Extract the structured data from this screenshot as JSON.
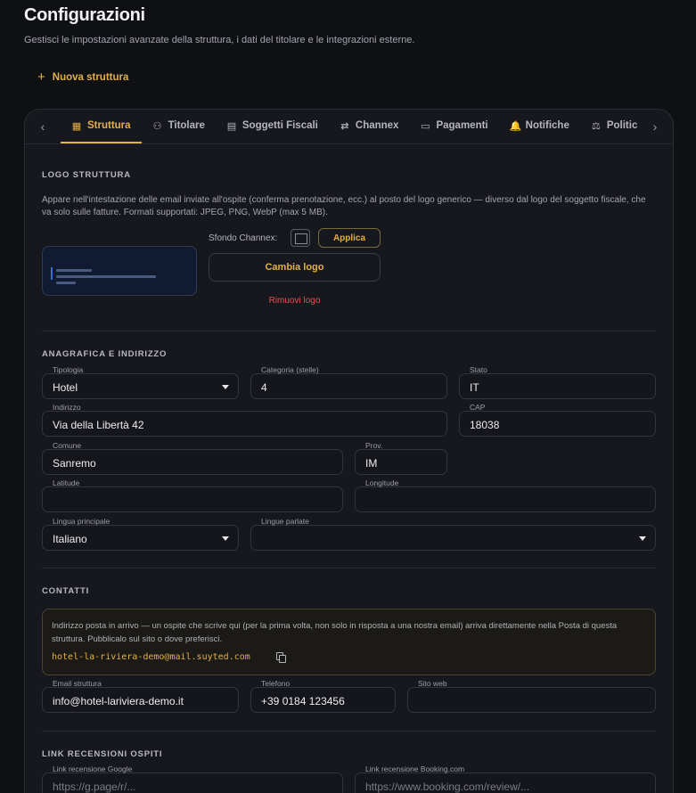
{
  "header": {
    "title": "Configurazioni",
    "subtitle": "Gestisci le impostazioni avanzate della struttura, i dati del titolare e le integrazioni esterne.",
    "new_structure_label": "Nuova struttura"
  },
  "tabs": [
    {
      "label": "Struttura",
      "icon": "building-icon",
      "glyph": "▦",
      "active": true
    },
    {
      "label": "Titolare",
      "icon": "user-icon",
      "glyph": "⚇",
      "active": false
    },
    {
      "label": "Soggetti Fiscali",
      "icon": "receipt-icon",
      "glyph": "▤",
      "active": false
    },
    {
      "label": "Channex",
      "icon": "swap-icon",
      "glyph": "⇄",
      "active": false
    },
    {
      "label": "Pagamenti",
      "icon": "credit-card-icon",
      "glyph": "▭",
      "active": false
    },
    {
      "label": "Notifiche",
      "icon": "bell-icon",
      "glyph": "🔔",
      "active": false
    },
    {
      "label": "Politic",
      "icon": "gavel-icon",
      "glyph": "⚖",
      "active": false
    }
  ],
  "logo_section": {
    "title": "LOGO STRUTTURA",
    "description": "Appare nell'intestazione delle email inviate all'ospite (conferma prenotazione, ecc.) al posto del logo generico — diverso dal logo del soggetto fiscale, che va solo sulle fatture. Formati supportati: JPEG, PNG, WebP (max 5 MB).",
    "background_label": "Sfondo Channex:",
    "apply_label": "Applica",
    "change_logo_label": "Cambia logo",
    "remove_logo_label": "Rimuovi logo"
  },
  "registry_section": {
    "title": "ANAGRAFICA E INDIRIZZO",
    "tipologia": {
      "label": "Tipologia",
      "value": "Hotel"
    },
    "categoria": {
      "label": "Categoria (stelle)",
      "value": "4"
    },
    "stato": {
      "label": "Stato",
      "value": "IT"
    },
    "indirizzo": {
      "label": "Indirizzo",
      "value": "Via della Libertà 42"
    },
    "cap": {
      "label": "CAP",
      "value": "18038"
    },
    "comune": {
      "label": "Comune",
      "value": "Sanremo"
    },
    "prov": {
      "label": "Prov.",
      "value": "IM"
    },
    "latitude": {
      "label": "Latitude",
      "value": ""
    },
    "longitude": {
      "label": "Longitude",
      "value": ""
    },
    "lingua_principale": {
      "label": "Lingua principale",
      "value": "Italiano"
    },
    "lingue_parlate": {
      "label": "Lingue parlate",
      "value": ""
    }
  },
  "contacts_section": {
    "title": "CONTATTI",
    "inbox_text": "Indirizzo posta in arrivo — un ospite che scrive qui (per la prima volta, non solo in risposta a una nostra email) arriva direttamente nella Posta di questa struttura. Pubblicalo sul sito o dove preferisci.",
    "inbox_email": "hotel-la-riviera-demo@mail.suyted.com",
    "email": {
      "label": "Email struttura",
      "value": "info@hotel-lariviera-demo.it"
    },
    "phone": {
      "label": "Telefono",
      "value": "+39 0184 123456"
    },
    "website": {
      "label": "Sito web",
      "value": ""
    }
  },
  "reviews_section": {
    "title": "LINK RECENSIONI OSPITI",
    "google": {
      "label": "Link recensione Google",
      "placeholder": "https://g.page/r/..."
    },
    "booking": {
      "label": "Link recensione Booking.com",
      "placeholder": "https://www.booking.com/review/..."
    }
  },
  "colors": {
    "accent": "#e2b04a",
    "danger": "#e55353",
    "background": "#0f1014",
    "card": "#17181d"
  }
}
